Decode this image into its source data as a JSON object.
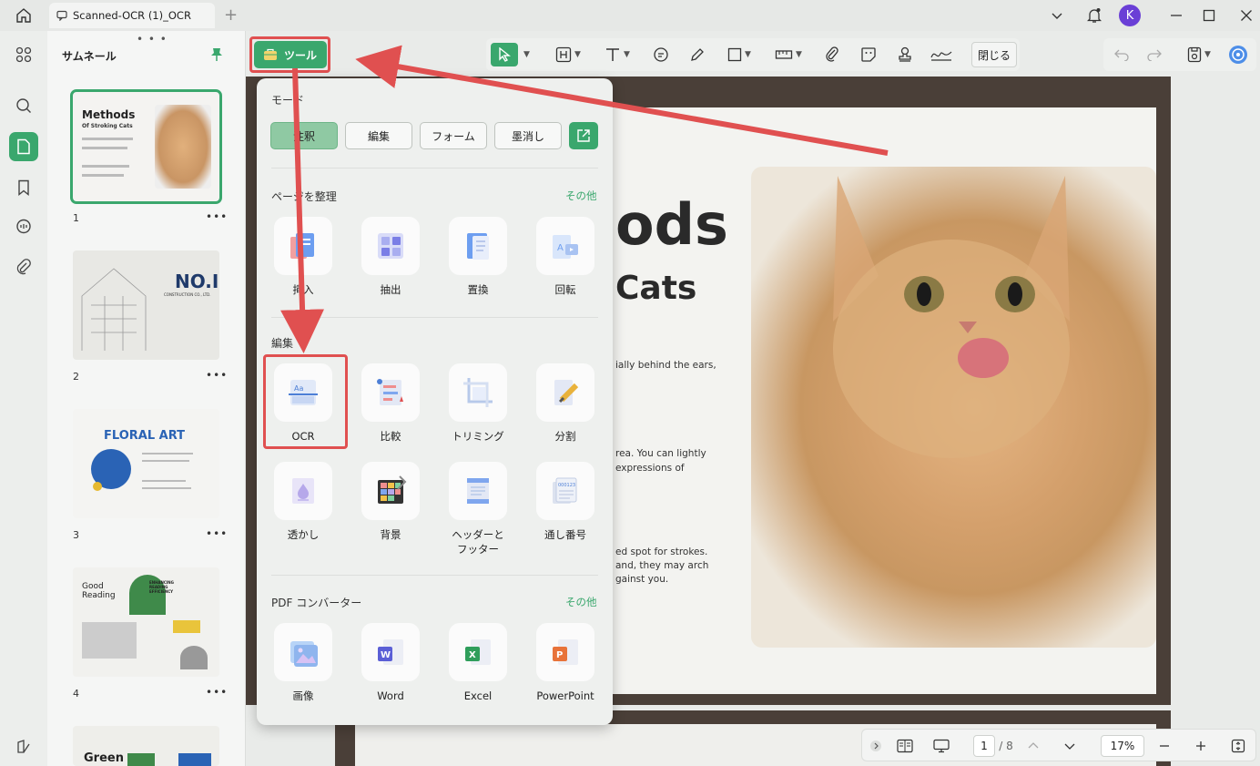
{
  "titlebar": {
    "tab_label": "Scanned-OCR (1)_OCR",
    "avatar_letter": "K"
  },
  "thumbnails": {
    "title": "サムネール",
    "pages": [
      {
        "num": "1",
        "title": "Methods",
        "subtitle": "Of Stroking Cats"
      },
      {
        "num": "2",
        "title": "NO.I",
        "subtitle": "CONSTRUCTION CO., LTD."
      },
      {
        "num": "3",
        "title": "FLORAL ART"
      },
      {
        "num": "4",
        "title": "Good Reading",
        "subtitle": "ENHANCING READING EFFICIENCY"
      },
      {
        "num": "",
        "title": "Green"
      }
    ]
  },
  "toolbar": {
    "tools_label": "ツール",
    "close_label": "閉じる"
  },
  "popup": {
    "mode_label": "モード",
    "modes": [
      "注釈",
      "編集",
      "フォーム",
      "墨消し"
    ],
    "organize_label": "ページを整理",
    "more_label": "その他",
    "organize_items": [
      "挿入",
      "抽出",
      "置換",
      "回転"
    ],
    "edit_label": "編集",
    "edit_items": [
      "OCR",
      "比較",
      "トリミング",
      "分割",
      "透かし",
      "背景",
      "ヘッダーと\nフッター",
      "通し番号"
    ],
    "converter_label": "PDF コンバーター",
    "converter_items": [
      "画像",
      "Word",
      "Excel",
      "PowerPoint"
    ]
  },
  "document": {
    "heading1": "ods",
    "heading2": "Cats",
    "lines": [
      "ially behind the ears,",
      "rea. You can lightly",
      "expressions of",
      "ed spot for strokes.",
      "and, they may arch",
      "gainst you."
    ]
  },
  "nav": {
    "page": "1",
    "total": "/ 8",
    "zoom": "17%"
  },
  "colors": {
    "accent": "#3aa76d",
    "highlight": "#e05050"
  }
}
